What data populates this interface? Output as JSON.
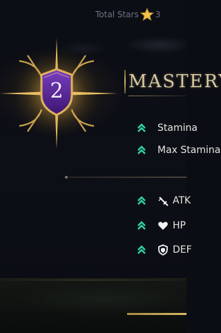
{
  "header": {
    "total_stars_label": "Total Stars",
    "total_stars_value": "3"
  },
  "mastery": {
    "level": "2",
    "title": "MASTERY"
  },
  "bonuses_top": [
    {
      "label": "Stamina"
    },
    {
      "label": "Max Stamina"
    }
  ],
  "bonuses_bottom": [
    {
      "icon": "sword-icon",
      "label": "ATK"
    },
    {
      "icon": "heart-icon",
      "label": "HP"
    },
    {
      "icon": "shield-icon",
      "label": "DEF"
    }
  ],
  "colors": {
    "accent_gold": "#d7b56a",
    "chevron_green": "#2fd6a0",
    "badge_purple": "#5a2a9a"
  }
}
